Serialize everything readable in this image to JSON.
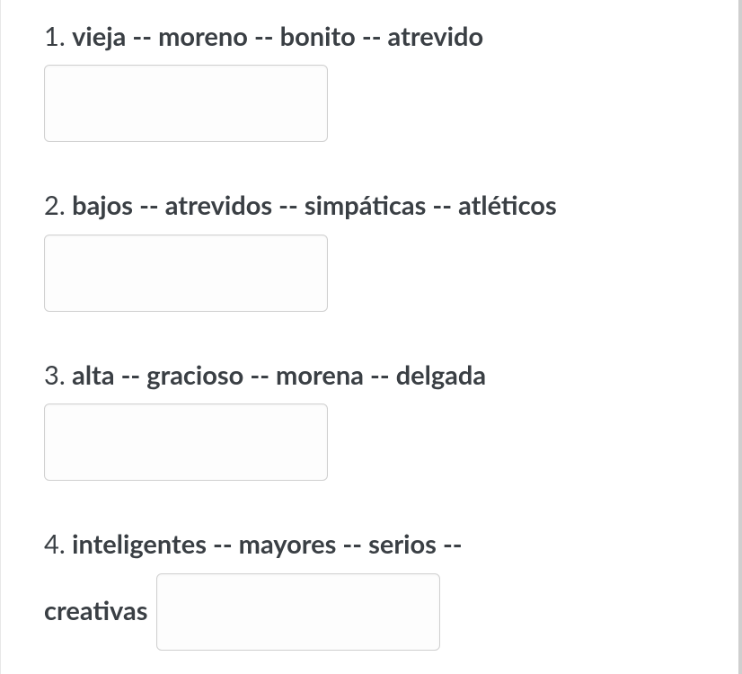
{
  "questions": [
    {
      "number": "1.",
      "prompt": "vieja -- moreno -- bonito -- atrevido",
      "value": ""
    },
    {
      "number": "2.",
      "prompt": "bajos -- atrevidos -- simpáticas -- atléticos",
      "value": ""
    },
    {
      "number": "3.",
      "prompt": "alta -- gracioso -- morena -- delgada",
      "value": ""
    },
    {
      "number": "4.",
      "prompt_part1": "inteligentes -- mayores -- serios --",
      "prompt_part2": "creativas",
      "value": ""
    }
  ]
}
